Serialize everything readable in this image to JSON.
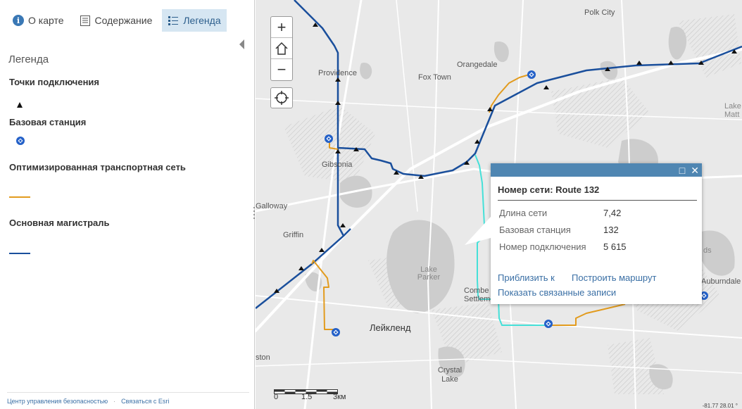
{
  "sidebar": {
    "tabs": [
      {
        "label": "О карте",
        "icon": "info-icon"
      },
      {
        "label": "Содержание",
        "icon": "content-list-icon"
      },
      {
        "label": "Легенда",
        "icon": "legend-icon"
      }
    ],
    "legend_title": "Легенда",
    "legend_items": [
      {
        "label": "Точки подключения",
        "symbol": "black-triangle"
      },
      {
        "label": "Базовая станция",
        "symbol": "blue-station-dot"
      },
      {
        "label": "Оптимизированная транспортная сеть",
        "symbol": "orange-line"
      },
      {
        "label": "Основная магистраль",
        "symbol": "blue-line"
      }
    ],
    "footer_links": [
      "Центр управления безопасностью",
      "Связаться с Esri"
    ]
  },
  "map": {
    "places": [
      "Polk City",
      "Orangedale",
      "Providence",
      "Fox Town",
      "Gibsonia",
      "Galloway",
      "Griffin",
      "Lake Parker",
      "Combe Settlement",
      "Лейкленд",
      "Auburndale",
      "Crystal Lake",
      "ston",
      "Lake Matt",
      "ds"
    ],
    "scale": {
      "labels": [
        "0",
        "1.5",
        "3км"
      ]
    },
    "coords": "-81.77 28.01 °",
    "colors": {
      "mainline": "#1a4f9c",
      "optimized": "#e29b1e",
      "selected": "#45e0d8",
      "station": "#2360c8"
    }
  },
  "popup": {
    "title": "Номер сети: Route 132",
    "fields": [
      {
        "label": "Длина сети",
        "value": "7,42"
      },
      {
        "label": "Базовая станция",
        "value": "132"
      },
      {
        "label": "Номер подключения",
        "value": "5 615"
      }
    ],
    "links": {
      "zoom": "Приблизить к",
      "route": "Построить маршрут",
      "related": "Показать связанные записи"
    }
  }
}
